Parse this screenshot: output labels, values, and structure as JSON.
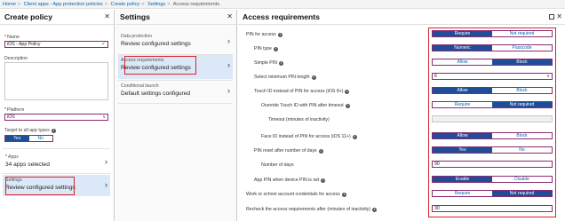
{
  "breadcrumb": [
    "Home",
    "Client apps - App protection policies",
    "Create policy",
    "Settings",
    "Access requirements"
  ],
  "blade1": {
    "title": "Create policy",
    "name_label": "Name",
    "name_value": "iOS - App Policy",
    "description_label": "Description",
    "platform_label": "Platform",
    "platform_value": "iOS",
    "target_label": "Target to all app types",
    "target_yes": "Yes",
    "target_no": "No",
    "apps_label": "Apps",
    "apps_value": "34 apps selected",
    "settings_label": "Settings",
    "settings_value": "Review configured settings"
  },
  "blade2": {
    "title": "Settings",
    "items": [
      {
        "label": "Data protection",
        "value": "Review configured settings"
      },
      {
        "label": "Access requirements",
        "value": "Review configured settings"
      },
      {
        "label": "Conditional launch",
        "value": "Default settings configured"
      }
    ]
  },
  "blade3": {
    "title": "Access requirements",
    "rows": [
      {
        "label": "PIN for access",
        "on": "Require",
        "off": "Not required",
        "selected": "Require"
      },
      {
        "label": "PIN type",
        "on": "Numeric",
        "off": "Passcode",
        "selected": "Numeric"
      },
      {
        "label": "Simple PIN",
        "on": "Allow",
        "off": "Block",
        "selected": "Block"
      },
      {
        "label": "Select minimum PIN length",
        "value": "6"
      },
      {
        "label": "Touch ID instead of PIN for access (iOS 8+)",
        "on": "Allow",
        "off": "Block",
        "selected": "Allow"
      },
      {
        "label": "Override Touch ID with PIN after timeout",
        "on": "Require",
        "off": "Not required",
        "selected": "Not required"
      },
      {
        "label": "Timeout (minutes of inactivity)",
        "value": ""
      },
      {
        "label": "Face ID instead of PIN for access (iOS 11+)",
        "on": "Allow",
        "off": "Block",
        "selected": "Allow"
      },
      {
        "label": "PIN reset after number of days",
        "on": "Yes",
        "off": "No",
        "selected": "Yes"
      },
      {
        "label": "Number of days",
        "value": "90"
      },
      {
        "label": "App PIN when device PIN is set",
        "on": "Enable",
        "off": "Disable",
        "selected": "Enable"
      },
      {
        "label": "Work or school account credentials for access",
        "on": "Require",
        "off": "Not required",
        "selected": "Not required"
      },
      {
        "label": "Recheck the access requirements after (minutes of inactivity)",
        "value": "30"
      }
    ]
  },
  "icons": {
    "close": "close-icon",
    "maximize": "maximize-icon",
    "info": "info-icon",
    "chevron": "chevron-right-icon",
    "check": "check-icon",
    "dropdown": "chevron-down-icon"
  },
  "colors": {
    "accent": "#1f4e99",
    "focus_border": "#8b2a73",
    "highlight": "#d9262c",
    "link": "#0063b1"
  }
}
